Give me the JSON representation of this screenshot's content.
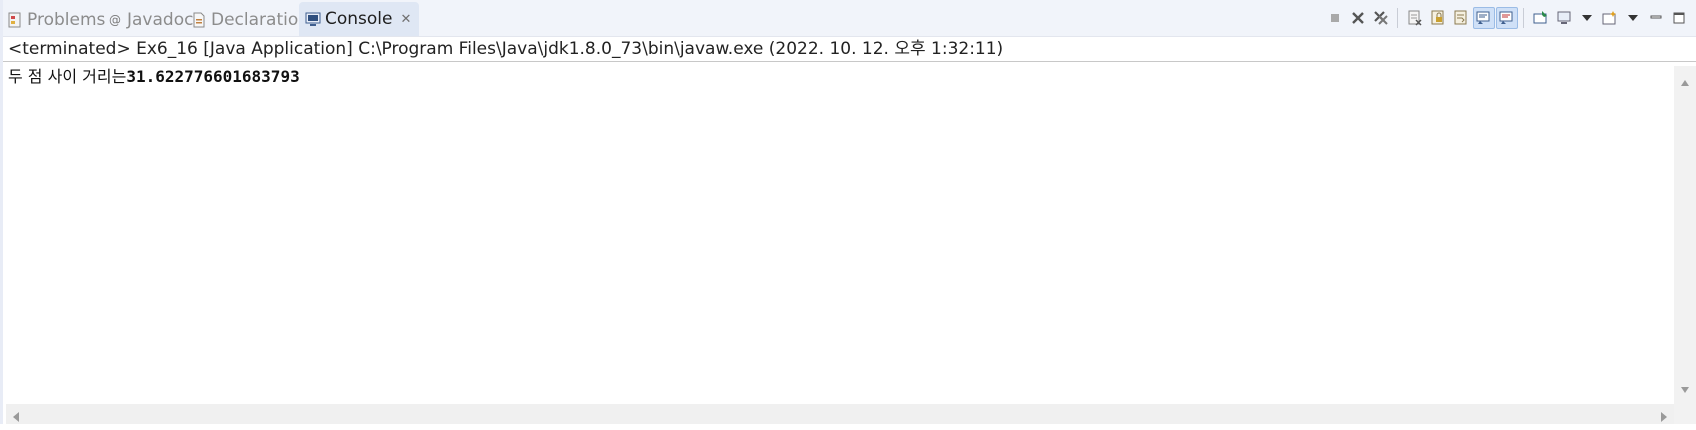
{
  "tabs": [
    {
      "label": "Problems",
      "icon": "problems-icon",
      "active": false
    },
    {
      "label": "Javadoc",
      "icon": "at-icon",
      "active": false
    },
    {
      "label": "Declaration",
      "icon": "declaration-icon",
      "active": false
    },
    {
      "label": "Console",
      "icon": "console-icon",
      "active": true
    }
  ],
  "toolbar": [
    "terminate-icon",
    "remove-launch-icon",
    "remove-all-terminated-icon",
    "clear-console-icon",
    "scroll-lock-icon",
    "word-wrap-icon",
    "show-on-stdout-icon",
    "show-on-stderr-icon",
    "pin-console-icon",
    "display-console-icon",
    "dropdown-icon",
    "open-console-icon",
    "dropdown-icon",
    "minimize-icon",
    "maximize-icon"
  ],
  "console": {
    "header": "<terminated> Ex6_16 [Java Application] C:\\Program Files\\Java\\jdk1.8.0_73\\bin\\javaw.exe  (2022. 10. 12. 오후 1:32:11)",
    "output_label": "두 점 사이 거리는",
    "output_value": "31.622776601683793"
  },
  "colors": {
    "tabbar_bg": "#f1f4fa",
    "active_tab_bg": "#dfe7f4",
    "inactive_text": "#8c8c8c"
  }
}
